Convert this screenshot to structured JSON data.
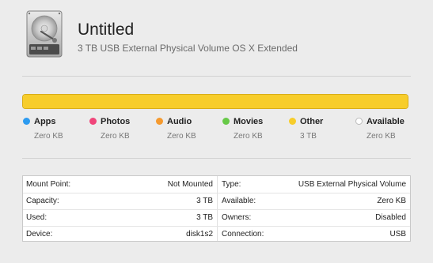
{
  "disk": {
    "name": "Untitled",
    "description": "3 TB USB External Physical Volume OS X Extended",
    "icon": "hard-drive-icon"
  },
  "usage": {
    "total": "3 TB",
    "categories": [
      {
        "key": "apps",
        "label": "Apps",
        "size": "Zero KB",
        "color": "#2d9bf0",
        "fraction": 0
      },
      {
        "key": "photos",
        "label": "Photos",
        "size": "Zero KB",
        "color": "#f0457a",
        "fraction": 0
      },
      {
        "key": "audio",
        "label": "Audio",
        "size": "Zero KB",
        "color": "#f59a2f",
        "fraction": 0
      },
      {
        "key": "movies",
        "label": "Movies",
        "size": "Zero KB",
        "color": "#67c947",
        "fraction": 0
      },
      {
        "key": "other",
        "label": "Other",
        "size": "3 TB",
        "color": "#f7cd2b",
        "fraction": 1
      },
      {
        "key": "available",
        "label": "Available",
        "size": "Zero KB",
        "color": "#ffffff",
        "fraction": 0
      }
    ]
  },
  "info": {
    "mount_point": {
      "label": "Mount Point:",
      "value": "Not Mounted"
    },
    "capacity": {
      "label": "Capacity:",
      "value": "3 TB"
    },
    "used": {
      "label": "Used:",
      "value": "3 TB"
    },
    "device": {
      "label": "Device:",
      "value": "disk1s2"
    },
    "type": {
      "label": "Type:",
      "value": "USB External Physical Volume"
    },
    "available": {
      "label": "Available:",
      "value": "Zero KB"
    },
    "owners": {
      "label": "Owners:",
      "value": "Disabled"
    },
    "connection": {
      "label": "Connection:",
      "value": "USB"
    }
  }
}
